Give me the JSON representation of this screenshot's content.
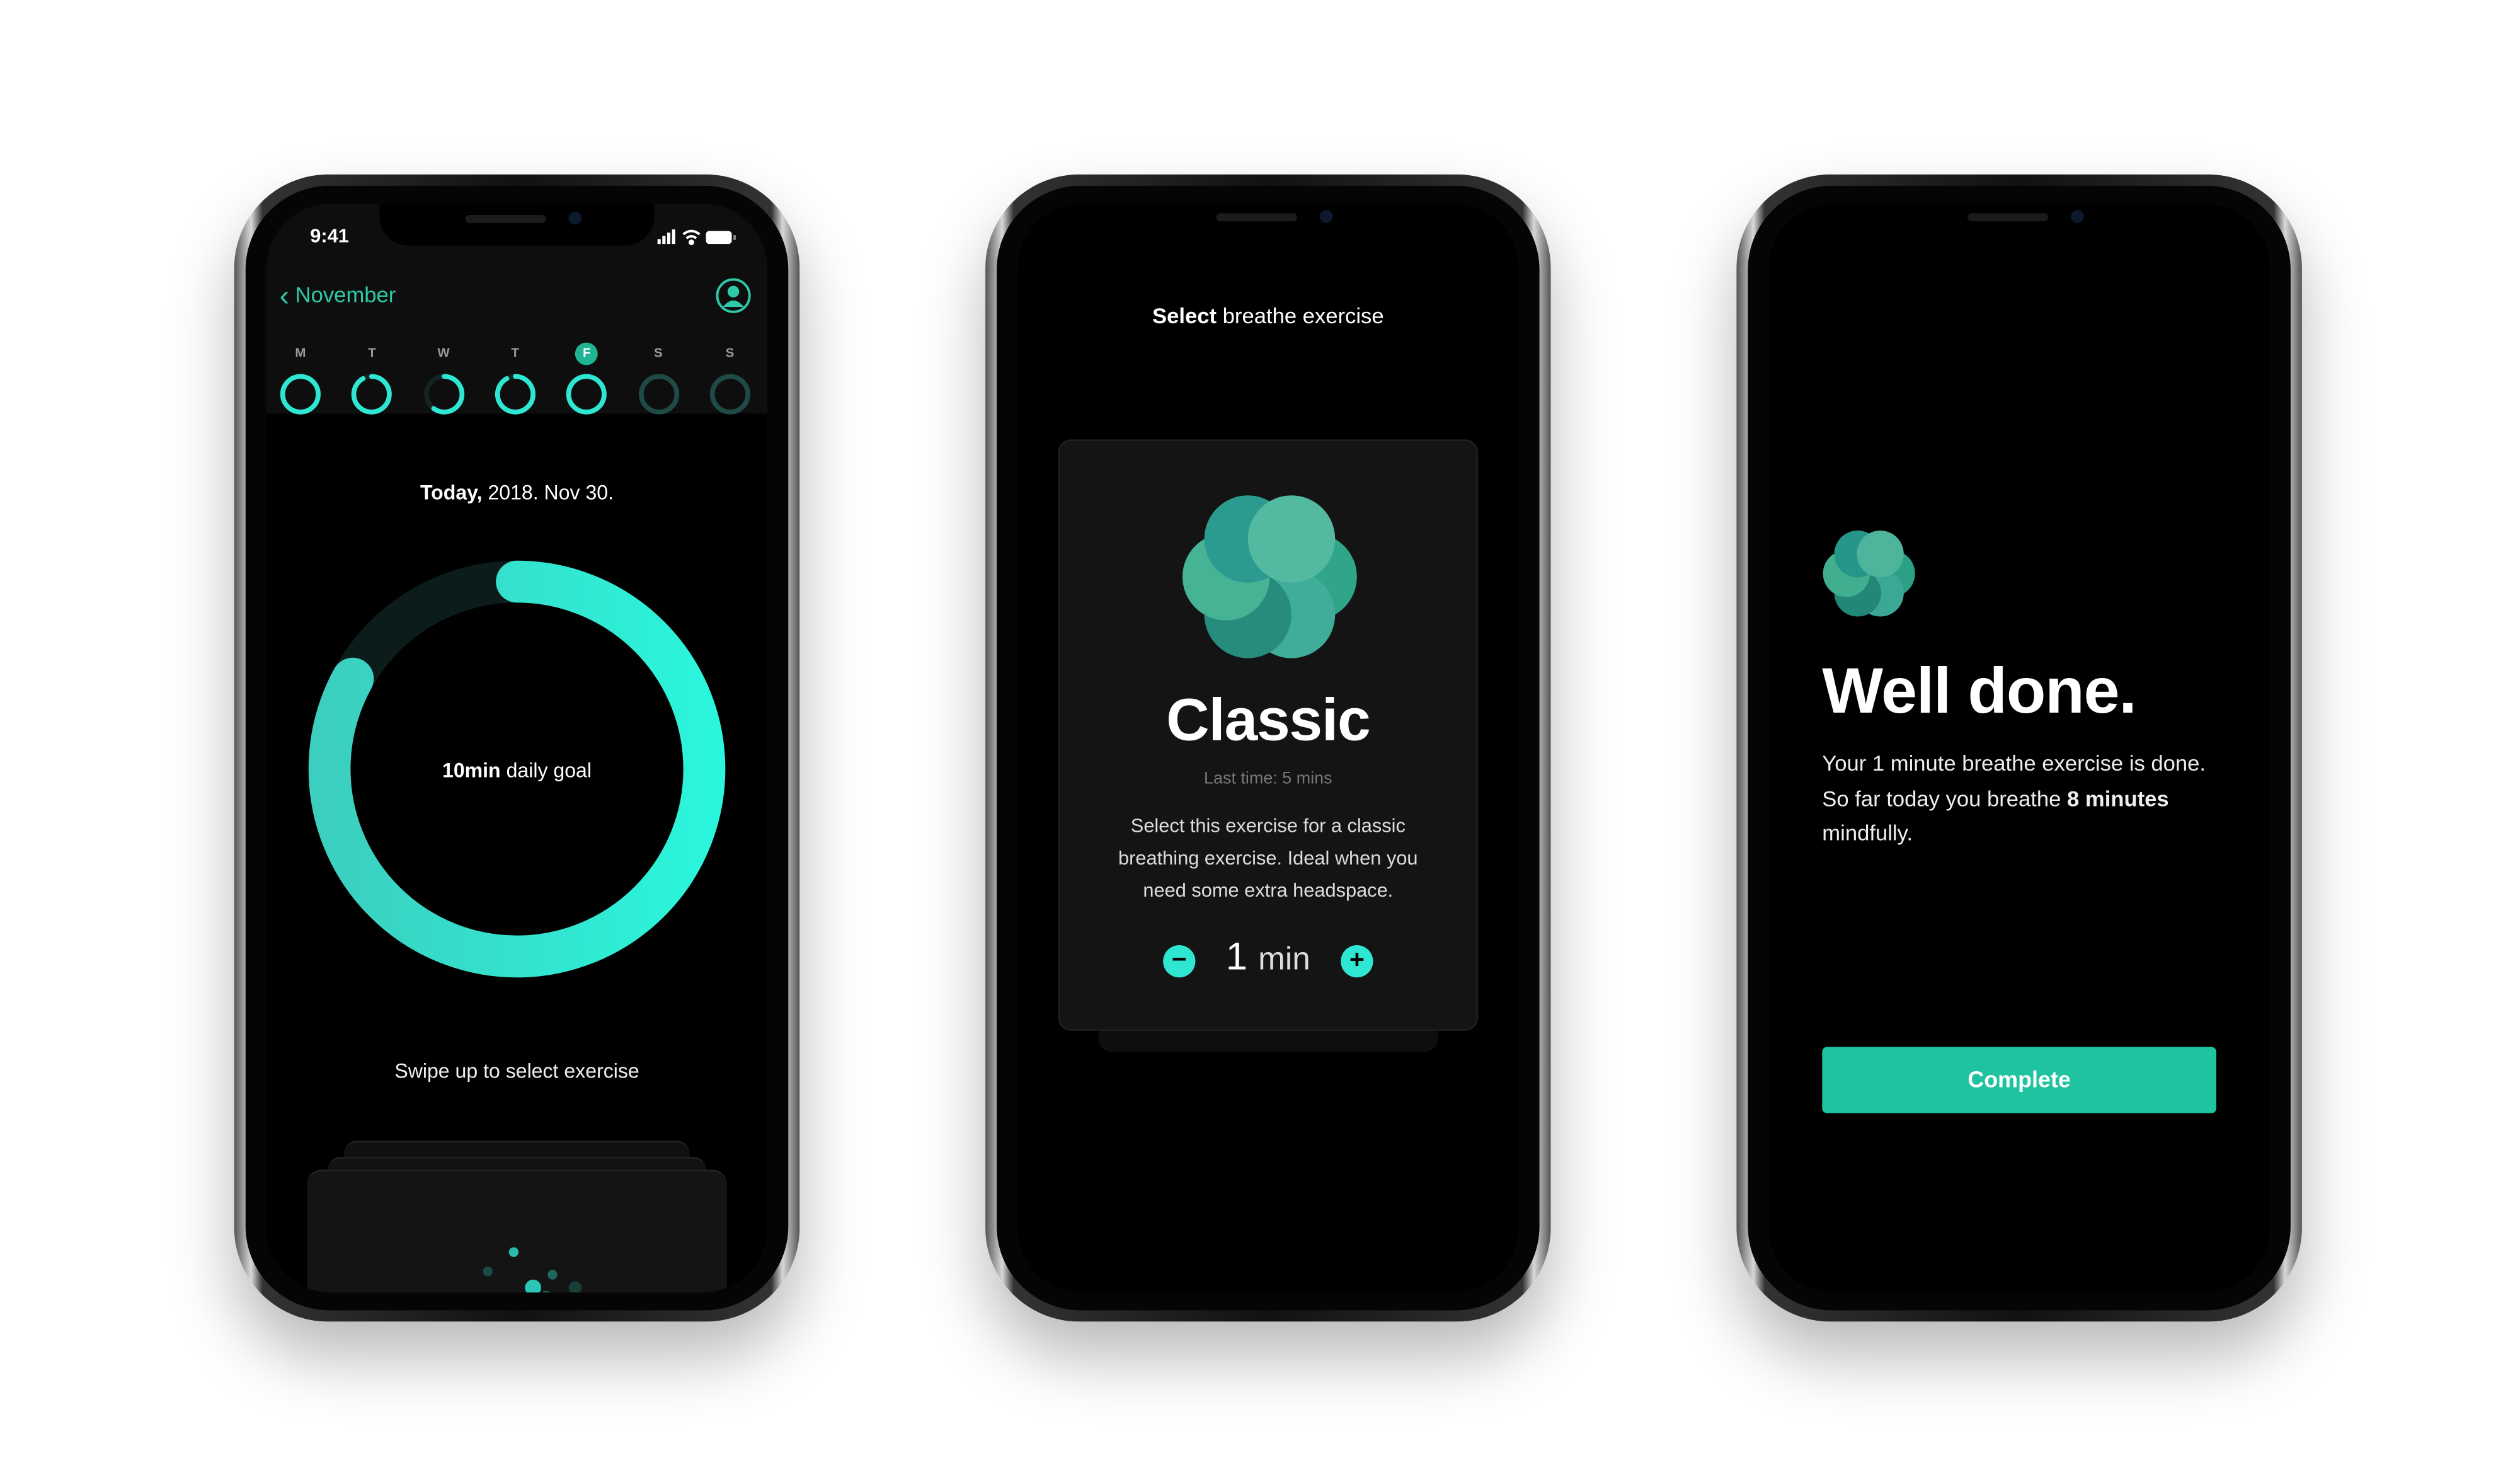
{
  "colors": {
    "accent": "#2ee6d2",
    "accent_dark": "#1fb89a",
    "button": "#20c3a0",
    "card": "#141414"
  },
  "phone1": {
    "status": {
      "time": "9:41",
      "icons": [
        "signal-icon",
        "wifi-icon",
        "battery-icon"
      ]
    },
    "nav": {
      "back_label": "November",
      "profile_icon": "profile-icon"
    },
    "week": [
      {
        "day": "M",
        "progress": 1.0,
        "selected": false
      },
      {
        "day": "T",
        "progress": 0.92,
        "selected": false
      },
      {
        "day": "W",
        "progress": 0.6,
        "selected": false
      },
      {
        "day": "T",
        "progress": 0.92,
        "selected": false
      },
      {
        "day": "F",
        "progress": 1.0,
        "selected": true
      },
      {
        "day": "S",
        "progress": 0,
        "selected": false
      },
      {
        "day": "S",
        "progress": 0,
        "selected": false
      }
    ],
    "date_bold": "Today,",
    "date_rest": " 2018. Nov 30.",
    "goal_bold": "10min",
    "goal_rest": " daily goal",
    "goal_progress": 0.83,
    "swipe_hint": "Swipe up to select exercise"
  },
  "phone2": {
    "title_bold": "Select",
    "title_rest": " breathe exercise",
    "card": {
      "name": "Classic",
      "last_time": "Last time: 5 mins",
      "description": "Select this exercise for a classic breathing exercise. Ideal when you need some extra headspace.",
      "duration_value": "1",
      "duration_unit": "min"
    }
  },
  "phone3": {
    "heading": "Well done.",
    "line1": "Your 1 minute breathe exercise is done.",
    "line2_pre": "So far today you breathe ",
    "line2_bold": "8 minutes",
    "line3": "mindfully.",
    "button": "Complete"
  }
}
